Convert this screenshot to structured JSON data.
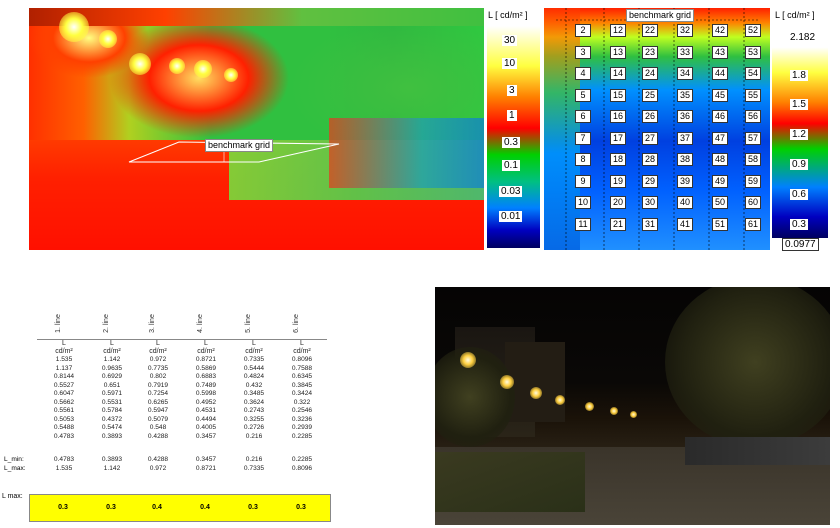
{
  "false_color_photo": {
    "grid_label": "benchmark grid"
  },
  "left_scale": {
    "title": "L [ cd/m² ]",
    "ticks": [
      "30",
      "10",
      "3",
      "1",
      "0.3",
      "0.1",
      "0.03",
      "0.01"
    ]
  },
  "heatmap": {
    "grid_label": "benchmark grid",
    "rows": [
      [
        "2",
        "12",
        "22",
        "32",
        "42",
        "52"
      ],
      [
        "3",
        "13",
        "23",
        "33",
        "43",
        "53"
      ],
      [
        "4",
        "14",
        "24",
        "34",
        "44",
        "54"
      ],
      [
        "5",
        "15",
        "25",
        "35",
        "45",
        "55"
      ],
      [
        "6",
        "16",
        "26",
        "36",
        "46",
        "56"
      ],
      [
        "7",
        "17",
        "27",
        "37",
        "47",
        "57"
      ],
      [
        "8",
        "18",
        "28",
        "38",
        "48",
        "58"
      ],
      [
        "9",
        "19",
        "29",
        "39",
        "49",
        "59"
      ],
      [
        "10",
        "20",
        "30",
        "40",
        "50",
        "60"
      ],
      [
        "11",
        "21",
        "31",
        "41",
        "51",
        "61"
      ]
    ]
  },
  "right_scale": {
    "title": "L [ cd/m² ]",
    "ticks": [
      "2.182",
      "1.8",
      "1.5",
      "1.2",
      "0.9",
      "0.6",
      "0.3",
      "0.0977"
    ]
  },
  "table": {
    "line_headers": [
      "1. line",
      "2. line",
      "3. line",
      "4. line",
      "5. line",
      "6. line"
    ],
    "col_symbols": [
      "L",
      "L",
      "L",
      "L",
      "L",
      "L"
    ],
    "units": [
      "cd/m²",
      "cd/m²",
      "cd/m²",
      "cd/m²",
      "cd/m²",
      "cd/m²"
    ],
    "rows": [
      [
        "1.535",
        "1.142",
        "0.972",
        "0.8721",
        "0.7335",
        "0.8096"
      ],
      [
        "1.137",
        "0.9635",
        "0.7735",
        "0.5869",
        "0.5444",
        "0.7588"
      ],
      [
        "0.8144",
        "0.6929",
        "0.802",
        "0.6883",
        "0.4824",
        "0.6345"
      ],
      [
        "0.5527",
        "0.651",
        "0.7919",
        "0.7489",
        "0.432",
        "0.3845"
      ],
      [
        "0.6047",
        "0.5971",
        "0.7254",
        "0.5998",
        "0.3485",
        "0.3424"
      ],
      [
        "0.5662",
        "0.5531",
        "0.6265",
        "0.4952",
        "0.3624",
        "0.322"
      ],
      [
        "0.5561",
        "0.5784",
        "0.5947",
        "0.4531",
        "0.2743",
        "0.2546"
      ],
      [
        "0.5053",
        "0.4372",
        "0.5079",
        "0.4494",
        "0.3255",
        "0.3236"
      ],
      [
        "0.5488",
        "0.5474",
        "0.548",
        "0.4005",
        "0.2726",
        "0.2939"
      ],
      [
        "0.4783",
        "0.3893",
        "0.4288",
        "0.3457",
        "0.216",
        "0.2285"
      ]
    ],
    "lmin_label": "L_min:",
    "lmin": [
      "0.4783",
      "0.3893",
      "0.4288",
      "0.3457",
      "0.216",
      "0.2285"
    ],
    "lmax_label": "L_max:",
    "lmax": [
      "1.535",
      "1.142",
      "0.972",
      "0.8721",
      "0.7335",
      "0.8096"
    ],
    "ymax_label": "L max:",
    "ymax": [
      "0.3",
      "0.3",
      "0.4",
      "0.4",
      "0.3",
      "0.3"
    ]
  }
}
